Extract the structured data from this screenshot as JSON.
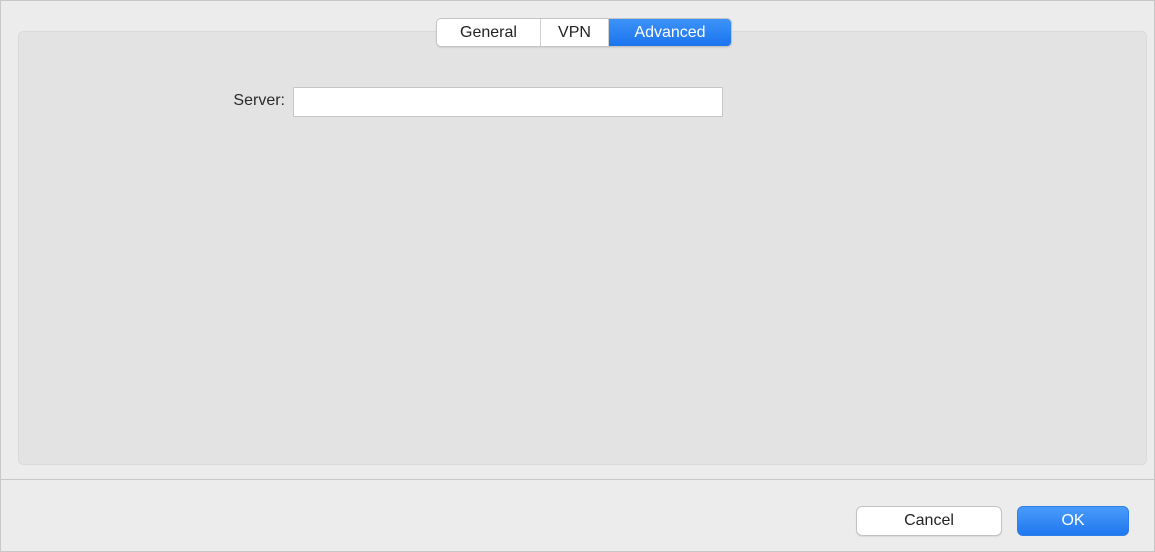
{
  "tabs": [
    {
      "label": "General",
      "selected": false
    },
    {
      "label": "VPN",
      "selected": false
    },
    {
      "label": "Advanced",
      "selected": true
    }
  ],
  "form": {
    "server_label": "Server:",
    "server_value": "",
    "server_placeholder": ""
  },
  "buttons": {
    "cancel_label": "Cancel",
    "ok_label": "OK"
  },
  "colors": {
    "accent": "#1c74ef",
    "window_bg": "#ececec",
    "panel_bg": "#e3e3e3"
  }
}
